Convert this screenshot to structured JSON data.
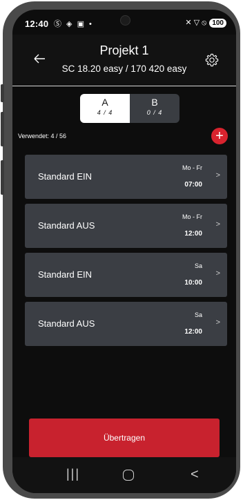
{
  "status_bar": {
    "time": "12:40",
    "left_icons": "Ⓢ ◈ ▣ •",
    "right_icons": "✕ ▽ ⦸",
    "battery": "100"
  },
  "header": {
    "title": "Projekt 1",
    "subtitle": "SC 18.20 easy / 170 420 easy"
  },
  "segments": [
    {
      "label": "A",
      "count": "4 / 4"
    },
    {
      "label": "B",
      "count": "0 / 4"
    }
  ],
  "used": "Verwendet: 4 / 56",
  "add_label": "+",
  "rows": [
    {
      "label": "Standard EIN",
      "days": "Mo - Fr",
      "time": "07:00"
    },
    {
      "label": "Standard AUS",
      "days": "Mo - Fr",
      "time": "12:00"
    },
    {
      "label": "Standard EIN",
      "days": "Sa",
      "time": "10:00"
    },
    {
      "label": "Standard AUS",
      "days": "Sa",
      "time": "12:00"
    }
  ],
  "submit_label": "Übertragen",
  "nav": {
    "recent": "|||",
    "back": "<"
  },
  "colors": {
    "accent": "#c8222e",
    "row_bg": "#3b3e44",
    "screen_bg": "#0d0d0d"
  },
  "icons": {
    "back": "arrow-left-icon",
    "settings": "gear-icon",
    "add": "plus-circle-icon",
    "chevron": "chevron-right-icon"
  }
}
